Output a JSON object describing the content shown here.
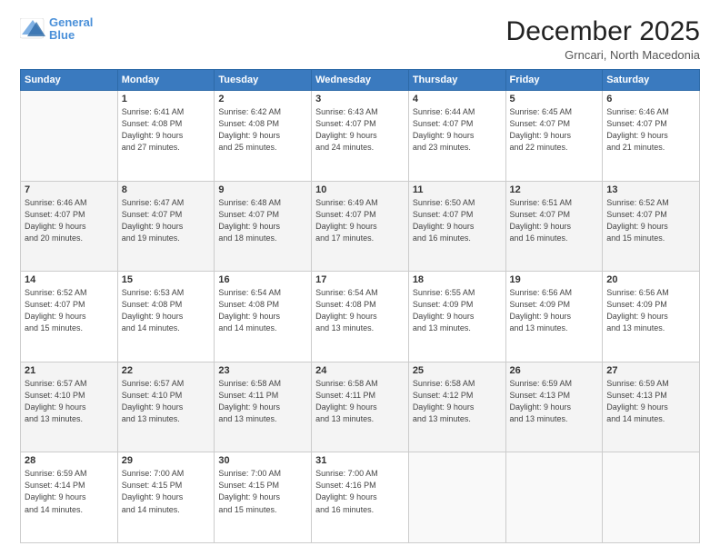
{
  "header": {
    "logo_line1": "General",
    "logo_line2": "Blue",
    "title": "December 2025",
    "subtitle": "Grncari, North Macedonia"
  },
  "days_of_week": [
    "Sunday",
    "Monday",
    "Tuesday",
    "Wednesday",
    "Thursday",
    "Friday",
    "Saturday"
  ],
  "weeks": [
    [
      {
        "day": "",
        "info": ""
      },
      {
        "day": "1",
        "info": "Sunrise: 6:41 AM\nSunset: 4:08 PM\nDaylight: 9 hours\nand 27 minutes."
      },
      {
        "day": "2",
        "info": "Sunrise: 6:42 AM\nSunset: 4:08 PM\nDaylight: 9 hours\nand 25 minutes."
      },
      {
        "day": "3",
        "info": "Sunrise: 6:43 AM\nSunset: 4:07 PM\nDaylight: 9 hours\nand 24 minutes."
      },
      {
        "day": "4",
        "info": "Sunrise: 6:44 AM\nSunset: 4:07 PM\nDaylight: 9 hours\nand 23 minutes."
      },
      {
        "day": "5",
        "info": "Sunrise: 6:45 AM\nSunset: 4:07 PM\nDaylight: 9 hours\nand 22 minutes."
      },
      {
        "day": "6",
        "info": "Sunrise: 6:46 AM\nSunset: 4:07 PM\nDaylight: 9 hours\nand 21 minutes."
      }
    ],
    [
      {
        "day": "7",
        "info": "Sunrise: 6:46 AM\nSunset: 4:07 PM\nDaylight: 9 hours\nand 20 minutes."
      },
      {
        "day": "8",
        "info": "Sunrise: 6:47 AM\nSunset: 4:07 PM\nDaylight: 9 hours\nand 19 minutes."
      },
      {
        "day": "9",
        "info": "Sunrise: 6:48 AM\nSunset: 4:07 PM\nDaylight: 9 hours\nand 18 minutes."
      },
      {
        "day": "10",
        "info": "Sunrise: 6:49 AM\nSunset: 4:07 PM\nDaylight: 9 hours\nand 17 minutes."
      },
      {
        "day": "11",
        "info": "Sunrise: 6:50 AM\nSunset: 4:07 PM\nDaylight: 9 hours\nand 16 minutes."
      },
      {
        "day": "12",
        "info": "Sunrise: 6:51 AM\nSunset: 4:07 PM\nDaylight: 9 hours\nand 16 minutes."
      },
      {
        "day": "13",
        "info": "Sunrise: 6:52 AM\nSunset: 4:07 PM\nDaylight: 9 hours\nand 15 minutes."
      }
    ],
    [
      {
        "day": "14",
        "info": "Sunrise: 6:52 AM\nSunset: 4:07 PM\nDaylight: 9 hours\nand 15 minutes."
      },
      {
        "day": "15",
        "info": "Sunrise: 6:53 AM\nSunset: 4:08 PM\nDaylight: 9 hours\nand 14 minutes."
      },
      {
        "day": "16",
        "info": "Sunrise: 6:54 AM\nSunset: 4:08 PM\nDaylight: 9 hours\nand 14 minutes."
      },
      {
        "day": "17",
        "info": "Sunrise: 6:54 AM\nSunset: 4:08 PM\nDaylight: 9 hours\nand 13 minutes."
      },
      {
        "day": "18",
        "info": "Sunrise: 6:55 AM\nSunset: 4:09 PM\nDaylight: 9 hours\nand 13 minutes."
      },
      {
        "day": "19",
        "info": "Sunrise: 6:56 AM\nSunset: 4:09 PM\nDaylight: 9 hours\nand 13 minutes."
      },
      {
        "day": "20",
        "info": "Sunrise: 6:56 AM\nSunset: 4:09 PM\nDaylight: 9 hours\nand 13 minutes."
      }
    ],
    [
      {
        "day": "21",
        "info": "Sunrise: 6:57 AM\nSunset: 4:10 PM\nDaylight: 9 hours\nand 13 minutes."
      },
      {
        "day": "22",
        "info": "Sunrise: 6:57 AM\nSunset: 4:10 PM\nDaylight: 9 hours\nand 13 minutes."
      },
      {
        "day": "23",
        "info": "Sunrise: 6:58 AM\nSunset: 4:11 PM\nDaylight: 9 hours\nand 13 minutes."
      },
      {
        "day": "24",
        "info": "Sunrise: 6:58 AM\nSunset: 4:11 PM\nDaylight: 9 hours\nand 13 minutes."
      },
      {
        "day": "25",
        "info": "Sunrise: 6:58 AM\nSunset: 4:12 PM\nDaylight: 9 hours\nand 13 minutes."
      },
      {
        "day": "26",
        "info": "Sunrise: 6:59 AM\nSunset: 4:13 PM\nDaylight: 9 hours\nand 13 minutes."
      },
      {
        "day": "27",
        "info": "Sunrise: 6:59 AM\nSunset: 4:13 PM\nDaylight: 9 hours\nand 14 minutes."
      }
    ],
    [
      {
        "day": "28",
        "info": "Sunrise: 6:59 AM\nSunset: 4:14 PM\nDaylight: 9 hours\nand 14 minutes."
      },
      {
        "day": "29",
        "info": "Sunrise: 7:00 AM\nSunset: 4:15 PM\nDaylight: 9 hours\nand 14 minutes."
      },
      {
        "day": "30",
        "info": "Sunrise: 7:00 AM\nSunset: 4:15 PM\nDaylight: 9 hours\nand 15 minutes."
      },
      {
        "day": "31",
        "info": "Sunrise: 7:00 AM\nSunset: 4:16 PM\nDaylight: 9 hours\nand 16 minutes."
      },
      {
        "day": "",
        "info": ""
      },
      {
        "day": "",
        "info": ""
      },
      {
        "day": "",
        "info": ""
      }
    ]
  ]
}
